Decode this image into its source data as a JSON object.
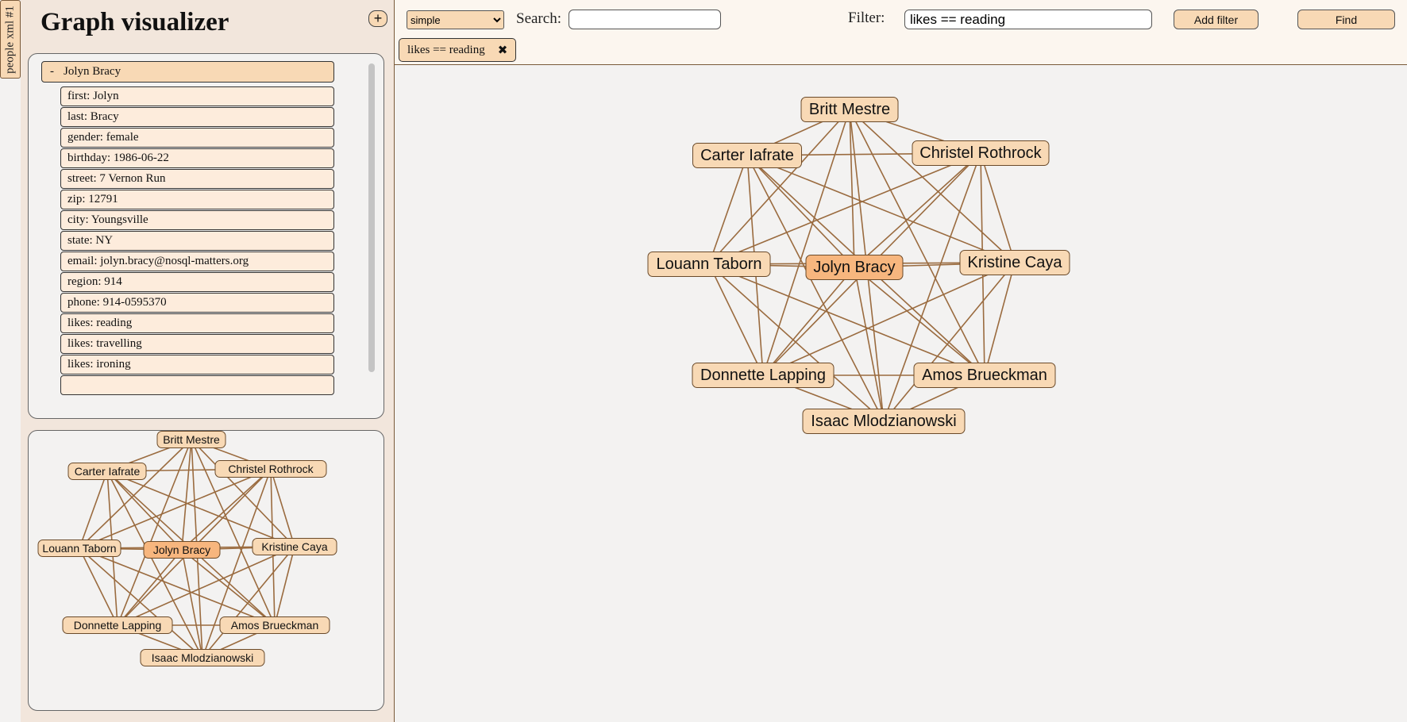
{
  "sidebar_tab": "people xml #1",
  "app_title": "Graph visualizer",
  "add_button": "+",
  "selected_node": {
    "collapse_symbol": "-",
    "name": "Jolyn Bracy",
    "properties": [
      "first: Jolyn",
      "last: Bracy",
      "gender: female",
      "birthday: 1986-06-22",
      "street: 7 Vernon Run",
      "zip: 12791",
      "city: Youngsville",
      "state: NY",
      "email: jolyn.bracy@nosql-matters.org",
      "region: 914",
      "phone: 914-0595370",
      "likes: reading",
      "likes: travelling",
      "likes: ironing"
    ]
  },
  "toolbar": {
    "layout_options": [
      "simple"
    ],
    "search_label": "Search:",
    "search_value": "",
    "filter_label": "Filter:",
    "filter_value": "likes == reading",
    "add_filter_label": "Add filter",
    "find_label": "Find"
  },
  "active_filter": {
    "label": "likes == reading",
    "remove_symbol": "✖"
  },
  "colors": {
    "node_fill": "#f8d9b5",
    "selected_node_fill": "#f7b67e",
    "edge": "#9a6b3f",
    "panel_bg": "#f2e6dc",
    "canvas_bg": "#f3f2f1"
  },
  "graph": {
    "nodes": [
      {
        "id": "britt",
        "label": "Britt Mestre",
        "selected": false
      },
      {
        "id": "carter",
        "label": "Carter Iafrate",
        "selected": false
      },
      {
        "id": "christel",
        "label": "Christel Rothrock",
        "selected": false
      },
      {
        "id": "louann",
        "label": "Louann Taborn",
        "selected": false
      },
      {
        "id": "jolyn",
        "label": "Jolyn Bracy",
        "selected": true
      },
      {
        "id": "kristine",
        "label": "Kristine Caya",
        "selected": false
      },
      {
        "id": "donnette",
        "label": "Donnette Lapping",
        "selected": false
      },
      {
        "id": "amos",
        "label": "Amos Brueckman",
        "selected": false
      },
      {
        "id": "isaac",
        "label": "Isaac Mlodzianowski",
        "selected": false
      }
    ],
    "edges": [
      [
        "britt",
        "carter"
      ],
      [
        "britt",
        "christel"
      ],
      [
        "britt",
        "louann"
      ],
      [
        "britt",
        "jolyn"
      ],
      [
        "britt",
        "kristine"
      ],
      [
        "britt",
        "donnette"
      ],
      [
        "britt",
        "amos"
      ],
      [
        "britt",
        "isaac"
      ],
      [
        "carter",
        "christel"
      ],
      [
        "carter",
        "louann"
      ],
      [
        "carter",
        "jolyn"
      ],
      [
        "carter",
        "kristine"
      ],
      [
        "carter",
        "donnette"
      ],
      [
        "carter",
        "amos"
      ],
      [
        "carter",
        "isaac"
      ],
      [
        "christel",
        "louann"
      ],
      [
        "christel",
        "jolyn"
      ],
      [
        "christel",
        "kristine"
      ],
      [
        "christel",
        "donnette"
      ],
      [
        "christel",
        "amos"
      ],
      [
        "christel",
        "isaac"
      ],
      [
        "louann",
        "jolyn"
      ],
      [
        "louann",
        "kristine"
      ],
      [
        "louann",
        "donnette"
      ],
      [
        "louann",
        "amos"
      ],
      [
        "louann",
        "isaac"
      ],
      [
        "jolyn",
        "kristine"
      ],
      [
        "jolyn",
        "donnette"
      ],
      [
        "jolyn",
        "amos"
      ],
      [
        "jolyn",
        "isaac"
      ],
      [
        "kristine",
        "donnette"
      ],
      [
        "kristine",
        "amos"
      ],
      [
        "kristine",
        "isaac"
      ],
      [
        "donnette",
        "amos"
      ],
      [
        "donnette",
        "isaac"
      ],
      [
        "amos",
        "isaac"
      ]
    ]
  }
}
